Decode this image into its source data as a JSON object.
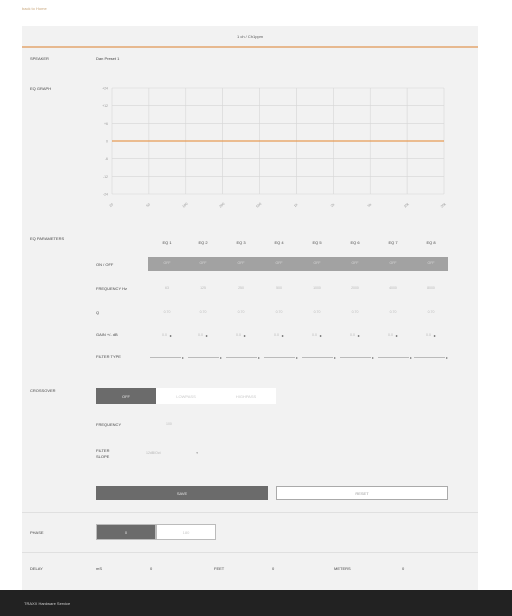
{
  "top_link": "back to Home",
  "channel_header": "1 ch / Ch1ppm",
  "speaker": {
    "label": "SPEAKER",
    "value": "Dan Preset 1"
  },
  "eq_graph": {
    "label": "EQ GRAPH",
    "y_ticks": [
      "+24",
      "+12",
      "+6",
      "0",
      "-6",
      "-12",
      "-24"
    ],
    "x_ticks": [
      "20",
      "50",
      "100",
      "200",
      "500",
      "1k",
      "2k",
      "5k",
      "10k",
      "20k"
    ],
    "line_color": "#e79b55",
    "grid_color": "#d6d6d6"
  },
  "eq_parameters": {
    "label": "EQ PARAMETERS",
    "columns": [
      "EQ 1",
      "EQ 2",
      "EQ 3",
      "EQ 4",
      "EQ 5",
      "EQ 6",
      "EQ 7",
      "EQ 8"
    ],
    "rows": {
      "onoff": {
        "label": "ON / OFF",
        "values": [
          "OFF",
          "OFF",
          "OFF",
          "OFF",
          "OFF",
          "OFF",
          "OFF",
          "OFF"
        ]
      },
      "frequency": {
        "label": "FREQUENCY Hz",
        "values": [
          "63",
          "125",
          "250",
          "500",
          "1000",
          "2000",
          "4000",
          "8000"
        ]
      },
      "q": {
        "label": "Q",
        "values": [
          "0.70",
          "0.70",
          "0.70",
          "0.70",
          "0.70",
          "0.70",
          "0.70",
          "0.70"
        ]
      },
      "gain": {
        "label": "GAIN +/- dB",
        "values": [
          "0.0",
          "0.0",
          "0.0",
          "0.0",
          "0.0",
          "0.0",
          "0.0",
          "0.0"
        ]
      },
      "filter_type": {
        "label": "FILTER TYPE",
        "values": [
          "",
          "",
          "",
          "",
          "",
          "",
          "",
          ""
        ]
      }
    }
  },
  "crossover": {
    "label": "CROSSOVER",
    "options": [
      "OFF",
      "LOWPASS",
      "HIGHPASS"
    ],
    "selected": "OFF",
    "frequency_label": "FREQUENCY",
    "frequency_value": "100",
    "filter_slope_label_1": "FILTER",
    "filter_slope_label_2": "SLOPE",
    "filter_slope_value": "12dB/Oct"
  },
  "buttons": {
    "save": "SAVE",
    "reset": "RESET"
  },
  "phase": {
    "label": "PHASE",
    "options": [
      "0",
      "180"
    ],
    "selected": "0"
  },
  "delay": {
    "label": "DELAY",
    "ms_label": "mS",
    "ms_value": "0",
    "feet_label": "FEET",
    "feet_value": "0",
    "meter_label": "METERS",
    "meter_value": "0"
  },
  "footer": {
    "text": "TRAXX Hardware Service"
  }
}
